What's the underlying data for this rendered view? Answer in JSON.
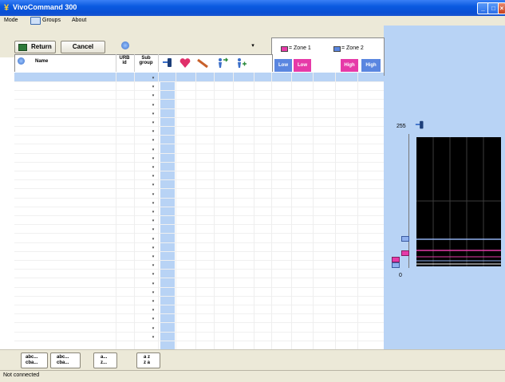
{
  "window": {
    "title": "VivoCommand 300"
  },
  "menu": {
    "items": [
      "Mode",
      "Groups",
      "About"
    ]
  },
  "toolbar": {
    "return_label": "Return",
    "cancel_label": "Cancel"
  },
  "legend": {
    "zone1_label": "= Zone 1",
    "zone2_label": "= Zone 2",
    "levels": [
      "Low",
      "Low",
      "High",
      "High"
    ],
    "colors": {
      "zone1": "#e63aa8",
      "zone2": "#5a86e0",
      "low": "#5a86e0",
      "low_zone1": "#e63aa8",
      "high_zone1": "#e63aa8",
      "high": "#5a86e0"
    }
  },
  "table": {
    "headers": {
      "name": "Name",
      "urb_line1": "URB",
      "urb_line2": "id",
      "sub_line1": "Sub",
      "sub_line2": "group"
    },
    "header_icons": [
      "slider-icon",
      "heart-icon",
      "tool-icon",
      "person-arrow-icon",
      "person-plus-icon"
    ]
  },
  "panel": {
    "scale_max": "255",
    "scale_min": "0"
  },
  "bottom": {
    "buttons": [
      {
        "top": "abc...",
        "bottom": "cba..."
      },
      {
        "top": "abc...",
        "bottom": "cba..."
      },
      {
        "top": "a...",
        "bottom": "z..."
      },
      {
        "top": "a z",
        "bottom": "z a"
      }
    ]
  },
  "status": {
    "text": "Not connected"
  }
}
